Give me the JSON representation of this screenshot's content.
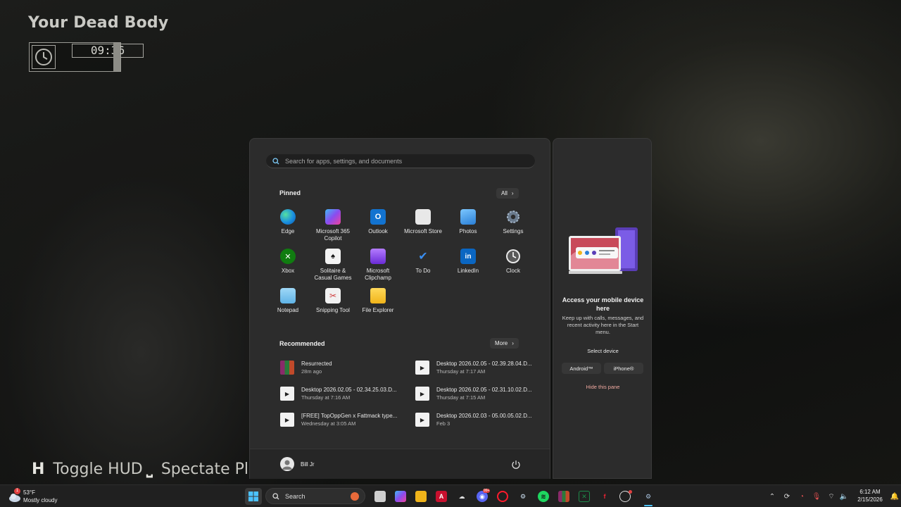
{
  "game": {
    "title": "Your Dead Body",
    "timer": "09:36",
    "hints": [
      {
        "key": "H",
        "label": "Toggle HUD"
      },
      {
        "key": "⎵",
        "label": "Spectate Pla"
      }
    ]
  },
  "start_menu": {
    "search_placeholder": "Search for apps, settings, and documents",
    "pinned_title": "Pinned",
    "all_label": "All",
    "pinned": [
      {
        "line1": "Edge",
        "line2": ""
      },
      {
        "line1": "Microsoft 365",
        "line2": "Copilot"
      },
      {
        "line1": "Outlook",
        "line2": ""
      },
      {
        "line1": "Microsoft Store",
        "line2": ""
      },
      {
        "line1": "Photos",
        "line2": ""
      },
      {
        "line1": "Settings",
        "line2": ""
      },
      {
        "line1": "Xbox",
        "line2": ""
      },
      {
        "line1": "Solitaire &",
        "line2": "Casual Games"
      },
      {
        "line1": "Microsoft",
        "line2": "Clipchamp"
      },
      {
        "line1": "To Do",
        "line2": ""
      },
      {
        "line1": "LinkedIn",
        "line2": ""
      },
      {
        "line1": "Clock",
        "line2": ""
      },
      {
        "line1": "Notepad",
        "line2": ""
      },
      {
        "line1": "Snipping Tool",
        "line2": ""
      },
      {
        "line1": "File Explorer",
        "line2": ""
      }
    ],
    "recommended_title": "Recommended",
    "more_label": "More",
    "recommended": [
      {
        "title": "Resurrected",
        "sub": "28m ago"
      },
      {
        "title": "Desktop 2026.02.05 - 02.39.28.04.D...",
        "sub": "Thursday at 7:17 AM"
      },
      {
        "title": "Desktop 2026.02.05 - 02.34.25.03.D...",
        "sub": "Thursday at 7:16 AM"
      },
      {
        "title": "Desktop 2026.02.05 - 02.31.10.02.D...",
        "sub": "Thursday at 7:15 AM"
      },
      {
        "title": "[FREE] TopOppGen x Fattmack type...",
        "sub": "Wednesday at 3:05 AM"
      },
      {
        "title": "Desktop 2026.02.03 - 05.00.05.02.D...",
        "sub": "Feb 3"
      }
    ],
    "user_name": "Bill Jr"
  },
  "side_pane": {
    "title": "Access your mobile device here",
    "description": "Keep up with calls, messages, and recent activity here in the Start menu.",
    "select_label": "Select device",
    "android_label": "Android™",
    "iphone_label": "iPhone®",
    "hide_label": "Hide this pane"
  },
  "taskbar": {
    "weather_temp": "53°F",
    "weather_condition": "Mostly cloudy",
    "weather_badge": "1",
    "search_label": "Search",
    "time": "6:12 AM",
    "date": "2/15/2026",
    "chat_badge": "99+"
  },
  "colors": {
    "accent_blue": "#0078d4",
    "hide_link": "#f0a9a0",
    "menu_bg": "#2c2c2c",
    "taskbar_bg": "#202020"
  }
}
